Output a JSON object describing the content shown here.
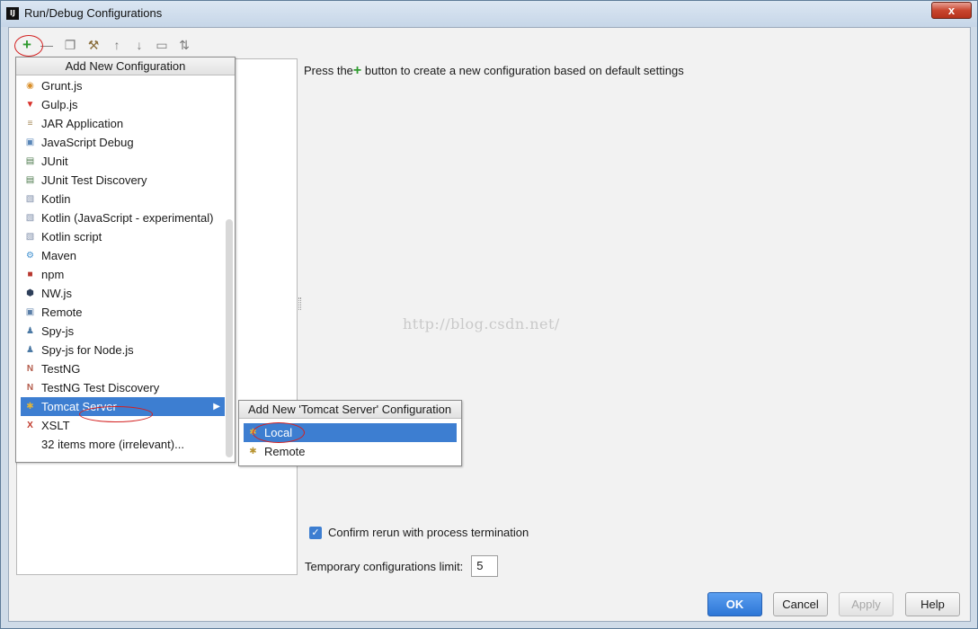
{
  "window": {
    "title": "Run/Debug Configurations",
    "app_icon_text": "IJ",
    "close_label": "x"
  },
  "toolbar": {
    "items": [
      "add-icon",
      "remove-icon",
      "copy-icon",
      "wrench-icon",
      "move-up-icon",
      "move-down-icon",
      "folder-icon",
      "sort-icon"
    ],
    "add_glyph": "+",
    "remove_glyph": "—",
    "copy_glyph": "❐",
    "wrench_glyph": "⚒",
    "up_glyph": "↑",
    "down_glyph": "↓",
    "folder_glyph": "▭",
    "sort_glyph": "⇅"
  },
  "hint": {
    "before": "Press the",
    "plus": "+",
    "after": " button to create a new configuration based on default settings"
  },
  "watermark": "http://blog.csdn.net/",
  "popup": {
    "title": "Add New Configuration",
    "items": [
      {
        "label": "Grunt.js",
        "icon": "grunt-icon",
        "glyph": "◉",
        "color": "#d98f2b"
      },
      {
        "label": "Gulp.js",
        "icon": "gulp-icon",
        "glyph": "▼",
        "color": "#d8312a"
      },
      {
        "label": "JAR Application",
        "icon": "jar-icon",
        "glyph": "≡",
        "color": "#a88c5c"
      },
      {
        "label": "JavaScript Debug",
        "icon": "javascript-debug-icon",
        "glyph": "▣",
        "color": "#5a87b8"
      },
      {
        "label": "JUnit",
        "icon": "junit-icon",
        "glyph": "▤",
        "color": "#4c7a4c"
      },
      {
        "label": "JUnit Test Discovery",
        "icon": "junit-discovery-icon",
        "glyph": "▤",
        "color": "#4c7a4c"
      },
      {
        "label": "Kotlin",
        "icon": "kotlin-icon",
        "glyph": "▧",
        "color": "#7d8ca8"
      },
      {
        "label": "Kotlin (JavaScript - experimental)",
        "icon": "kotlin-js-icon",
        "glyph": "▧",
        "color": "#7d8ca8"
      },
      {
        "label": "Kotlin script",
        "icon": "kotlin-script-icon",
        "glyph": "▧",
        "color": "#7d8ca8"
      },
      {
        "label": "Maven",
        "icon": "maven-icon",
        "glyph": "⚙",
        "color": "#3d8fcf"
      },
      {
        "label": "npm",
        "icon": "npm-icon",
        "glyph": "■",
        "color": "#b8372e"
      },
      {
        "label": "NW.js",
        "icon": "nwjs-icon",
        "glyph": "⬢",
        "color": "#2e3f5a"
      },
      {
        "label": "Remote",
        "icon": "remote-icon",
        "glyph": "▣",
        "color": "#5b7fa8"
      },
      {
        "label": "Spy-js",
        "icon": "spy-js-icon",
        "glyph": "♟",
        "color": "#4d7aa5"
      },
      {
        "label": "Spy-js for Node.js",
        "icon": "spy-js-node-icon",
        "glyph": "♟",
        "color": "#4d7aa5"
      },
      {
        "label": "TestNG",
        "icon": "testng-icon",
        "glyph": "N",
        "color": "#b35b4a"
      },
      {
        "label": "TestNG Test Discovery",
        "icon": "testng-discovery-icon",
        "glyph": "N",
        "color": "#b35b4a"
      },
      {
        "label": "Tomcat Server",
        "icon": "tomcat-icon",
        "glyph": "✱",
        "color": "#e0b53a",
        "selected": true
      },
      {
        "label": "XSLT",
        "icon": "xslt-icon",
        "glyph": "X",
        "color": "#c0392b"
      },
      {
        "label": "32 items more (irrelevant)...",
        "icon": "",
        "glyph": "",
        "color": "#000000"
      }
    ]
  },
  "submenu": {
    "title": "Add New 'Tomcat Server' Configuration",
    "items": [
      {
        "label": "Local",
        "icon": "tomcat-local-icon",
        "glyph": "✱",
        "color": "#e0b53a",
        "selected": true
      },
      {
        "label": "Remote",
        "icon": "tomcat-remote-icon",
        "glyph": "✱",
        "color": "#b89431"
      }
    ]
  },
  "options": {
    "confirm_rerun_label": "Confirm rerun with process termination",
    "confirm_rerun_checked": true,
    "temp_limit_label": "Temporary configurations limit:",
    "temp_limit_value": "5"
  },
  "buttons": {
    "ok": "OK",
    "cancel": "Cancel",
    "apply": "Apply",
    "help": "Help"
  }
}
